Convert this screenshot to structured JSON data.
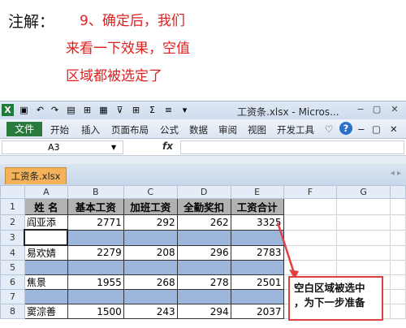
{
  "annotation": {
    "label": "注解：",
    "lines": [
      "9、确定后，我们",
      "来看一下效果，空值",
      "区域都被选定了"
    ]
  },
  "window": {
    "title": "工资条.xlsx - Micros...",
    "app_icon": "X"
  },
  "ribbon": {
    "file_tab": "文件",
    "tabs": [
      "开始",
      "插入",
      "页面布局",
      "公式",
      "数据",
      "审阅",
      "视图",
      "开发工具"
    ]
  },
  "formula_bar": {
    "name_box": "A3",
    "fx_label": "fx",
    "formula": ""
  },
  "workbook_tab": "工资条.xlsx",
  "sheet": {
    "columns": [
      "A",
      "B",
      "C",
      "D",
      "E",
      "F",
      "G"
    ],
    "row_numbers": [
      "1",
      "2",
      "3",
      "4",
      "5",
      "6",
      "7",
      "8"
    ],
    "header_row": [
      "姓 名",
      "基本工资",
      "加班工资",
      "全勤奖扣",
      "工资合计"
    ],
    "rows": [
      {
        "name": "阎亚添",
        "base": "2771",
        "overtime": "292",
        "attendance": "262",
        "total": "3325"
      },
      {
        "name": "易欢婧",
        "base": "2279",
        "overtime": "208",
        "attendance": "296",
        "total": "2783"
      },
      {
        "name": "焦景",
        "base": "1955",
        "overtime": "268",
        "attendance": "278",
        "total": "2501"
      },
      {
        "name": "窦淙善",
        "base": "1500",
        "overtime": "243",
        "attendance": "294",
        "total": "2037"
      }
    ]
  },
  "callout": {
    "line1": "空白区域被选中",
    "line2": "，为下一步准备"
  },
  "colors": {
    "annotation_red": "#e02020",
    "selection_blue": "#9db7dc",
    "header_gray": "#b2b2b2",
    "excel_green": "#2b7a3d"
  }
}
